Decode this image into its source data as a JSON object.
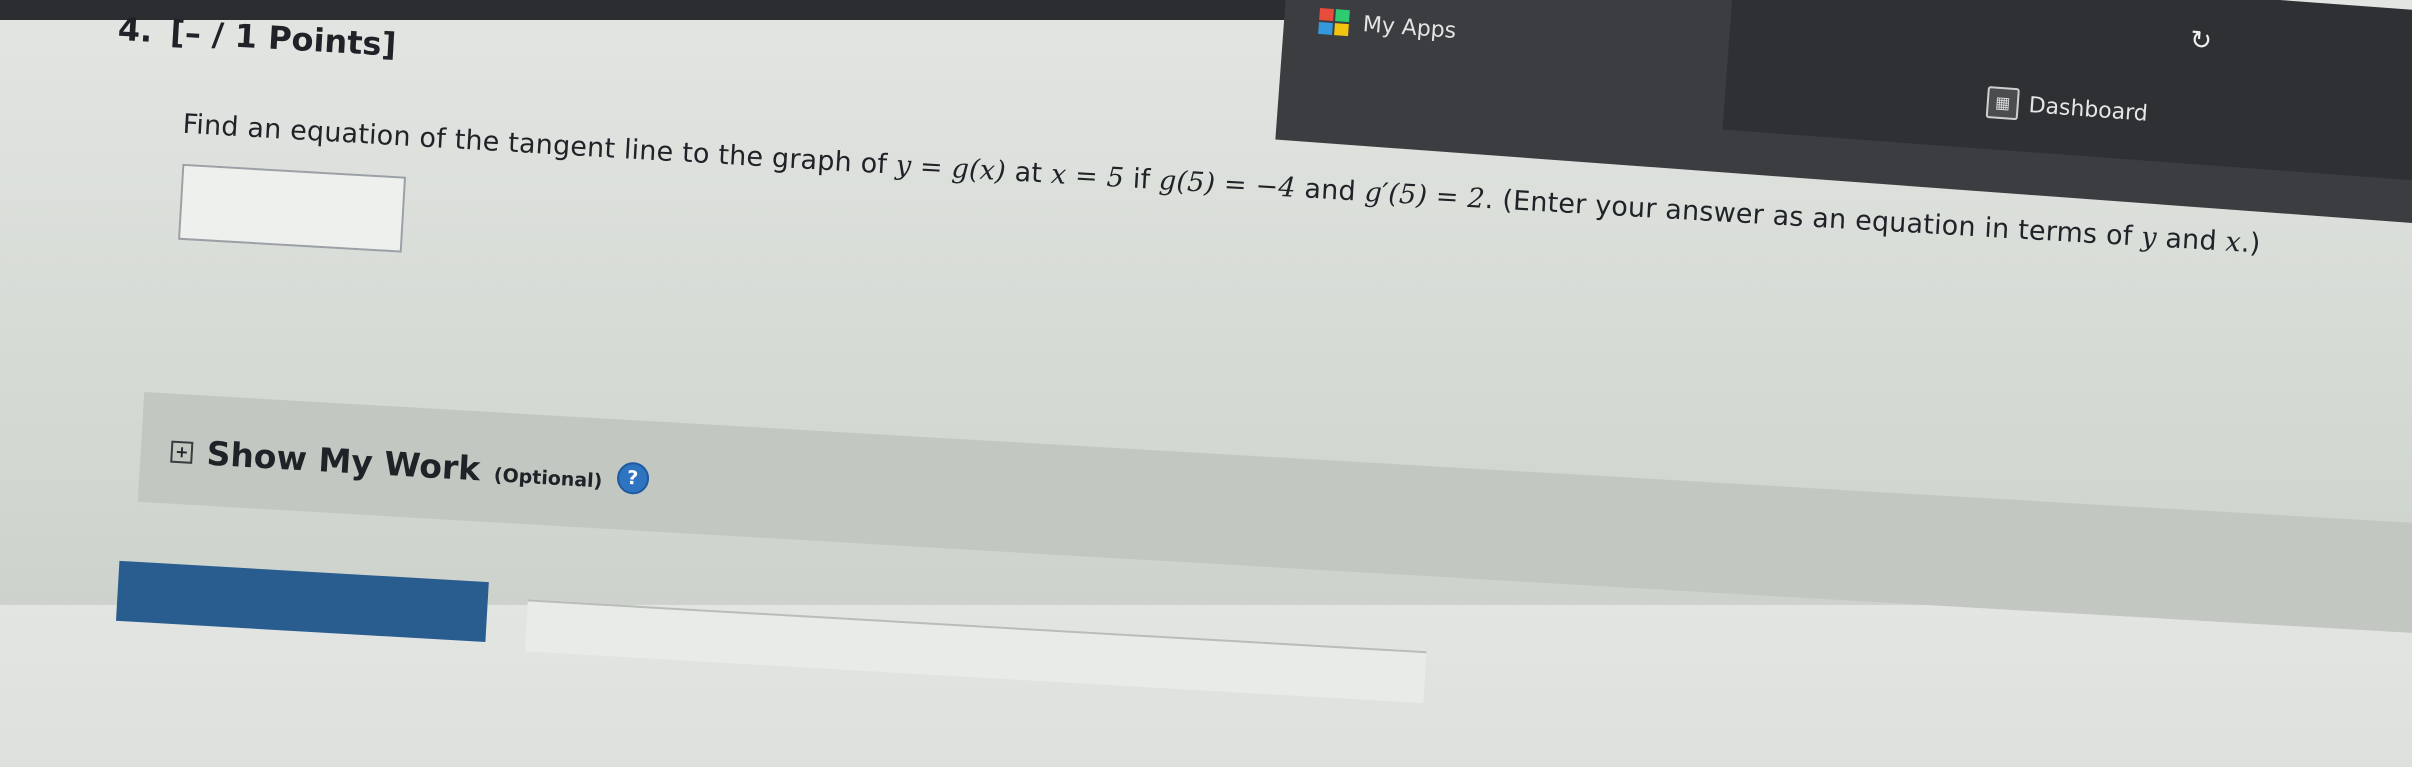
{
  "question": {
    "number": "4.",
    "points": "[– / 1 Points]",
    "text_parts": {
      "intro": "Find an equation of the tangent line to the graph of",
      "expr_fn": "y = g(x)",
      "at": "at",
      "expr_x": "x = 5",
      "if": "if",
      "expr_g5": "g(5) = −4",
      "and": "and",
      "expr_gprime": "g′(5) = 2",
      "instruction": ". (Enter your answer as an equation in terms of",
      "var_y": "y",
      "and2": "and",
      "var_x": "x",
      "close": ".)"
    }
  },
  "show_work": {
    "title": "Show My Work",
    "optional": "(Optional)",
    "help_glyph": "?"
  },
  "taskbar": {
    "apps_label": "My Apps",
    "dashboard_label": "Dashboard",
    "refresh_glyph": "↻"
  },
  "colors": {
    "apps_icon": [
      "#e74c3c",
      "#2ecc71",
      "#3498db",
      "#f1c40f"
    ],
    "help_blue": "#2f74c0",
    "submit_blue": "#2a5d8f"
  }
}
